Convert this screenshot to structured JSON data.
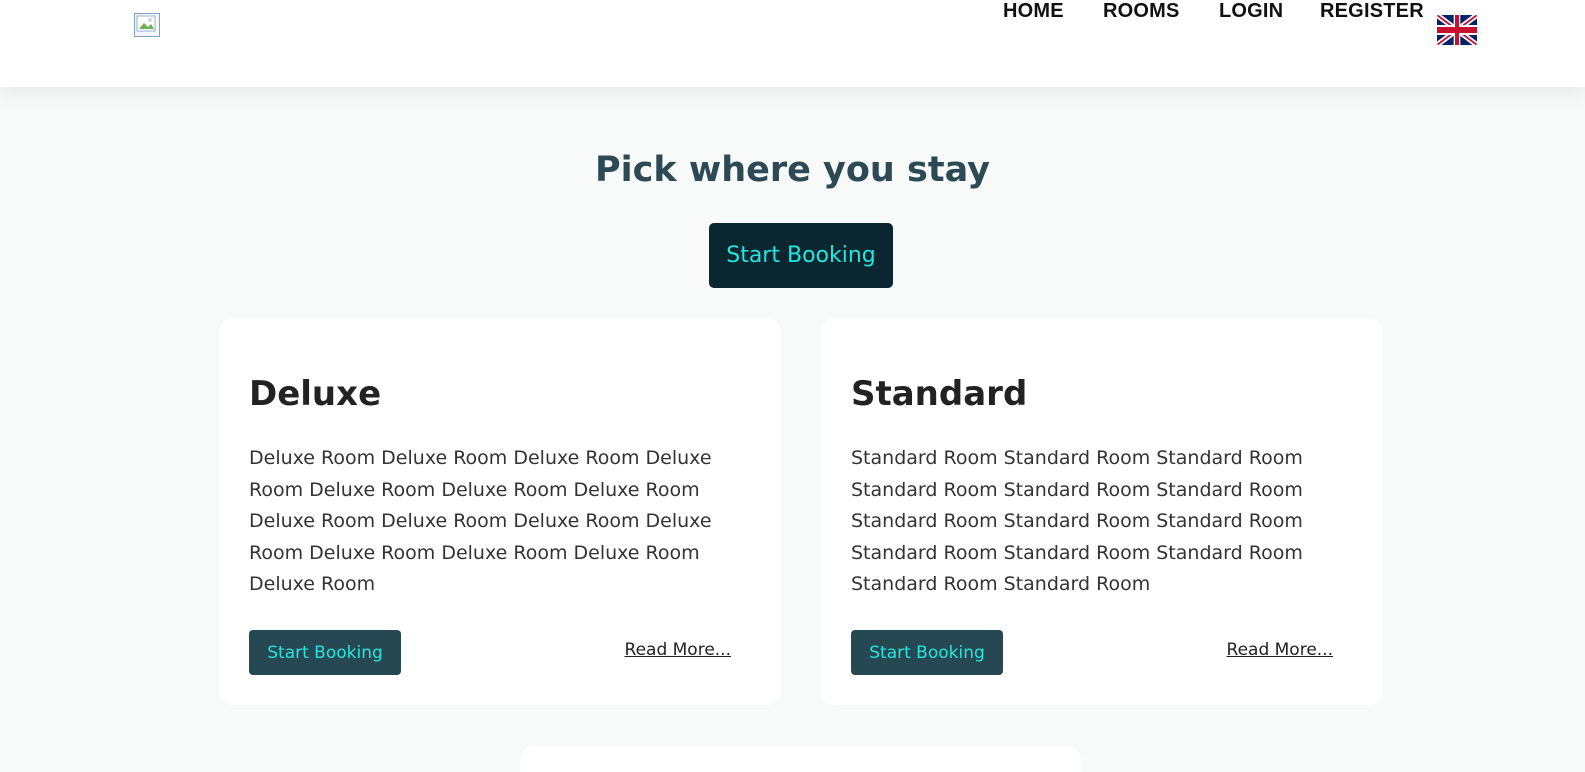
{
  "nav": {
    "links": [
      "HOME",
      "ROOMS",
      "LOGIN",
      "REGISTER"
    ],
    "language_flag": "uk-flag-icon"
  },
  "hero": {
    "title": "Pick where you stay",
    "button": "Start Booking"
  },
  "rooms": [
    {
      "name": "Deluxe",
      "description": "Deluxe Room Deluxe Room Deluxe Room Deluxe Room Deluxe Room Deluxe Room Deluxe Room Deluxe Room Deluxe Room Deluxe Room Deluxe Room Deluxe Room Deluxe Room Deluxe Room Deluxe Room",
      "book_label": "Start Booking",
      "more_label": "Read More..."
    },
    {
      "name": "Standard",
      "description": "Standard Room Standard Room Standard Room Standard Room Standard Room Standard Room Standard Room Standard Room Standard Room Standard Room Standard Room Standard Room Standard Room Standard Room",
      "book_label": "Start Booking",
      "more_label": "Read More..."
    }
  ],
  "colors": {
    "accent_text": "#20e6e0",
    "hero_button_bg": "#0a2630",
    "card_button_bg": "#264852",
    "title": "#2b4a55"
  }
}
